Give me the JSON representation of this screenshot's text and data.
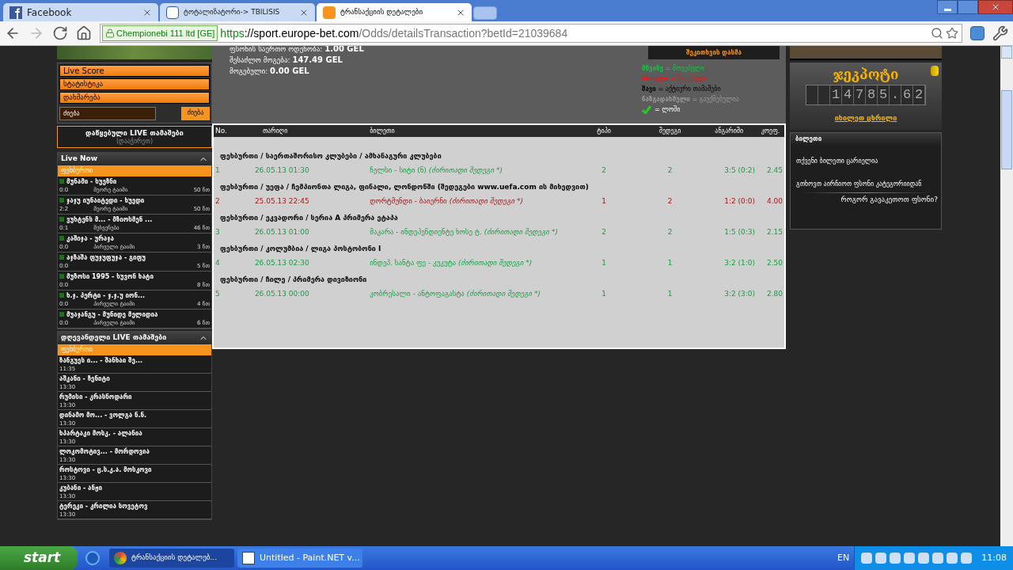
{
  "browser": {
    "tabs": [
      {
        "title": "Facebook",
        "kind": "facebook",
        "selected": false
      },
      {
        "title": "ტოტალიზატორი-> TBILISIS",
        "kind": "site",
        "selected": false
      },
      {
        "title": "ტრანსაქციის დეტალები",
        "kind": "bet",
        "selected": true
      }
    ],
    "security_badge": "Chempionebi 111 ltd [GE]",
    "url_scheme": "https",
    "url_host": "://sport.europe-bet.com",
    "url_path": "/Odds/detailsTransaction?betId=21039684"
  },
  "left": {
    "menu": [
      "Live Score",
      "სტატისტიკა",
      "დახმარება"
    ],
    "search": {
      "placeholder": "ძიება",
      "button": "ძიება"
    },
    "started_live": {
      "title": "დაწყებული LIVE თამაშები",
      "hint": "(დააჭირეთ)"
    },
    "live_now": {
      "title": "Live Now",
      "sport": "ფეხბურთი",
      "matches": [
        {
          "name": "მუნამი - ხუეზნი",
          "score": "0:0",
          "period": "მეორე ტაიმი",
          "minute": "50 წთ"
        },
        {
          "name": "ჯაჯუ იუნაიტედი - ხუედი",
          "score": "2:2",
          "period": "მეორე ტაიმი",
          "minute": "50 წთ"
        },
        {
          "name": "ვუხტენს მ... - მზიოსმენ ...",
          "score": "0:1",
          "period": "შესვენება",
          "minute": "46 წთ"
        },
        {
          "name": "კაშიჯა - ურაჯა",
          "score": "0:0",
          "period": "პირველი ტაიმი",
          "minute": "3 წთ"
        },
        {
          "name": "აჯზაშა ფუჯუფუჯა - გიფუ",
          "score": "0:0",
          "minute": "5 წთ"
        },
        {
          "name": "მუზოსი 1995 - ხუვონ ხატი",
          "score": "0:0",
          "minute": "8 წთ"
        },
        {
          "name": "ხ.ჯ. პერტი - ჯ.ჯ.უ იონ...",
          "score": "0:0",
          "period": "პირველი ტაიმი",
          "minute": "4 წთ"
        },
        {
          "name": "მუაჯანგუ - მუნიდე მელიდია",
          "score": "0:0",
          "period": "პირველი ტაიმი",
          "minute": "6 წთ"
        }
      ]
    },
    "today_live": {
      "title": "დღევანდელი LIVE თამაშები",
      "sport": "ფეხბურთი",
      "matches": [
        {
          "name": "ზანგუეს ი... - შანხაი შე...",
          "time": "11:35"
        },
        {
          "name": "აშკანი - ზენიტი",
          "time": "13:30"
        },
        {
          "name": "რუმისი - კრასნოდარი",
          "time": "13:30"
        },
        {
          "name": "დინამო მო... - ვოლგა ნ.ნ.",
          "time": "13:30"
        },
        {
          "name": "ხპარტაკი მოსკ. - ალანია",
          "time": "13:30"
        },
        {
          "name": "ლოკომოტივ... - მორდოვია",
          "time": "13:30"
        },
        {
          "name": "როსტოვი - ც.ს.კ.ა. მოსკოვი",
          "time": "13:30"
        },
        {
          "name": "კუბანი - ანჟი",
          "time": "13:30"
        },
        {
          "name": "ტერეკი - კრილია სოვეტოვ",
          "time": "13:30"
        }
      ]
    }
  },
  "summary": {
    "lines": [
      {
        "label": "ფსონის საერთო ოდენობა:",
        "value": "1.00 GEL"
      },
      {
        "label": "შესაძლო მოგება:",
        "value": "147.49 GEL"
      },
      {
        "label": "მოგებული:",
        "value": "0.00 GEL"
      }
    ],
    "ask_button": "შეკითხვის დასმა",
    "legend": [
      {
        "kind": "text",
        "term": "მწვანე",
        "meaning": "= მოგებული",
        "color": "#1fbf4a"
      },
      {
        "kind": "text",
        "term": "წითელი",
        "meaning": "= წაგებული",
        "color": "#e01c1c"
      },
      {
        "kind": "text",
        "term": "შავი",
        "meaning": "= აქტიური თამაშები",
        "color": "#000000"
      },
      {
        "kind": "text",
        "term": "ნაზგადახმული",
        "meaning": "= გაუქმებულია",
        "color": "#9a9a9a"
      },
      {
        "kind": "check",
        "meaning": "= ლოში",
        "color": "#22cc22"
      }
    ]
  },
  "table": {
    "columns": [
      "No.",
      "თარიღი",
      "ბილეთი",
      "ტიპი",
      "შედეგი",
      "ანგარიში",
      "კოეფ."
    ],
    "groups": [
      {
        "title": "ფეხბურთი / საერთაშორისო კლუბები / ამხანაგური კლუბები",
        "row": {
          "lost": false,
          "no": "1",
          "date": "26.05.13 01:30",
          "match": "ჩელსი - სიტი (ნ)",
          "market": "(ძირითადი შედეგი *)",
          "type": "2",
          "result": "2",
          "score": "3:5 (0:2)",
          "odds": "2.45"
        }
      },
      {
        "title": "ფეხბურთი / უეფა / ჩემპიონთა ლიგა, ფინალი, ლონდონში (შედეგები www.uefa.com ის მიხედვით)",
        "row": {
          "lost": true,
          "no": "2",
          "date": "25.05.13 22:45",
          "match": "დორტმუნდი - ბაიერნი",
          "market": "(ძირითადი შედეგი *)",
          "type": "1",
          "result": "2",
          "score": "1:2 (0:0)",
          "odds": "4.00"
        }
      },
      {
        "title": "ფეხბურთი / ეკვადორი / სერია A პრიმერა ეტაპა",
        "row": {
          "lost": false,
          "no": "3",
          "date": "26.05.13 01:00",
          "match": "მაკარა - ინდეპენდიენტე ხოსე ტ.",
          "market": "(ძირითადი შედეგი *)",
          "type": "2",
          "result": "2",
          "score": "1:5 (0:3)",
          "odds": "2.15"
        }
      },
      {
        "title": "ფეხბურთი / კოლუმბია / ლიგა პოსტობონი I",
        "row": {
          "lost": false,
          "no": "4",
          "date": "26.05.13 02:30",
          "match": "ინდეპ. სანტა ფე - კუკუტა",
          "market": "(ძირითადი შედეგი *)",
          "type": "1",
          "result": "1",
          "score": "3:2 (1:0)",
          "odds": "2.50"
        }
      },
      {
        "title": "ფეხბურთი / ჩილე / პრიმერა დივიზიონი",
        "row": {
          "lost": false,
          "no": "5",
          "date": "26.05.13 00:00",
          "match": "კობრესალი - ანტოფაგასტა",
          "market": "(ძირითადი შედეგი *)",
          "type": "1",
          "result": "1",
          "score": "3:2 (3:0)",
          "odds": "2.80"
        }
      }
    ]
  },
  "right": {
    "jackpot": {
      "title": "ჯეკპოტი",
      "amount": "14785.62",
      "link": "იხილეთ ცხრილი"
    },
    "ticket": {
      "title": "ბილეთი",
      "empty": "თქვენი ბილეთი ცარიელია",
      "hint": "გთხოვთ აირჩიოთ ფსონი კატეგორიიდან",
      "how": "როგორ გავაკეთოთ ფსონი?"
    }
  },
  "taskbar": {
    "start": "start",
    "tasks": [
      {
        "title": "ტრანსაქციის დეტალებ...",
        "kind": "chrome",
        "selected": true
      },
      {
        "title": "Untitled - Paint.NET v...",
        "kind": "paint",
        "selected": false
      }
    ],
    "lang": "EN",
    "time": "11:08"
  }
}
